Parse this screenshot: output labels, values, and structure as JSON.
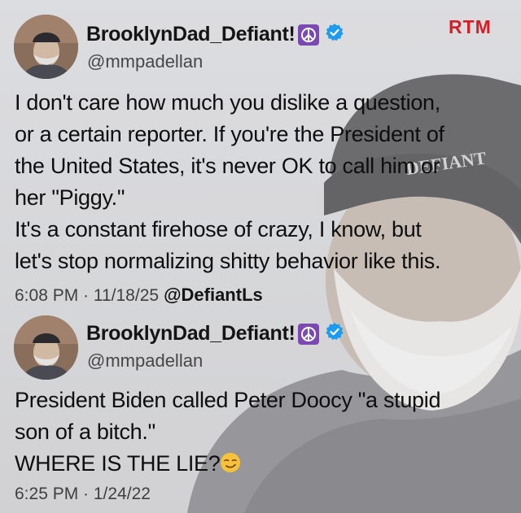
{
  "watermark": "RTM",
  "tweets": [
    {
      "display_name": "BrooklynDad_Defiant!",
      "handle": "@mmpadellan",
      "lines": [
        "I don't care how much you dislike a question,",
        "or a certain reporter. If you're the President of",
        "the United States, it's never OK to call him or",
        "her \"Piggy.\"",
        "It's a constant firehose of crazy, I know, but",
        "let's stop normalizing shitty behavior like this."
      ],
      "timestamp": "6:08 PM · 11/18/25",
      "credit": "@DefiantLs"
    },
    {
      "display_name": "BrooklynDad_Defiant!",
      "handle": "@mmpadellan",
      "lines": [
        "President Biden called Peter Doocy \"a stupid",
        "son of a bitch.\"",
        "WHERE IS THE LIE?"
      ],
      "timestamp": "6:25 PM · 1/24/22"
    }
  ],
  "icons": {
    "peace": "peace-symbol-icon",
    "verified": "verified-badge-icon",
    "emoji": "smirking-face-emoji-icon"
  },
  "colors": {
    "watermark": "#d81e24",
    "verified": "#1d9bf0",
    "peace_bg": "#7b49b1"
  }
}
